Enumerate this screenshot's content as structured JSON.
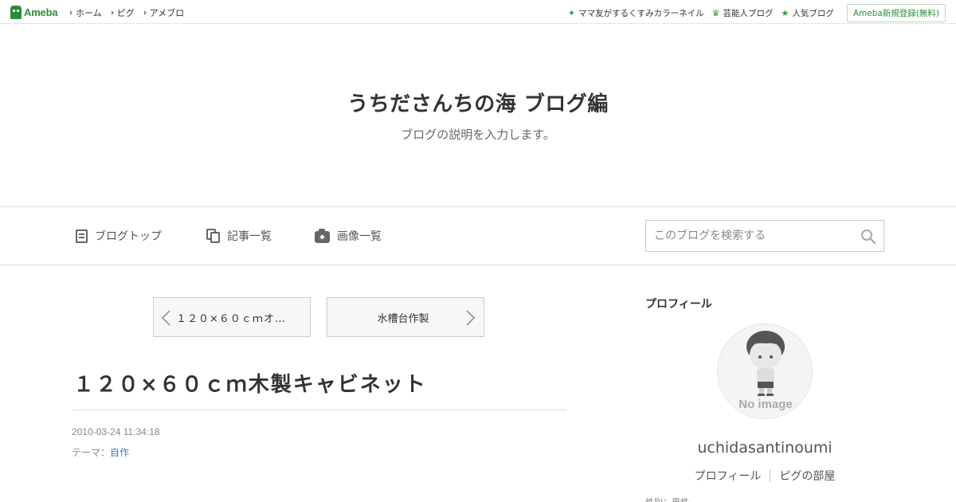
{
  "topbar": {
    "logo_text": "Ameba",
    "nav": [
      "ホーム",
      "ピグ",
      "アメブロ"
    ],
    "links": [
      {
        "label": "ママ友がするくすみカラーネイル",
        "icon": "star-icon"
      },
      {
        "label": "芸能人ブログ",
        "icon": "crown-icon"
      },
      {
        "label": "人気ブログ",
        "icon": "star-icon"
      }
    ],
    "register_label": "Ameba新規登録(無料)"
  },
  "blog": {
    "title": "うちださんちの海 ブログ編",
    "description": "ブログの説明を入力します。"
  },
  "gnav": {
    "items": [
      {
        "label": "ブログトップ",
        "icon": "document-icon"
      },
      {
        "label": "記事一覧",
        "icon": "copy-icon"
      },
      {
        "label": "画像一覧",
        "icon": "camera-icon"
      }
    ],
    "search_placeholder": "このブログを検索する"
  },
  "entry": {
    "prev_label": "１２０×６０ｃｍオ…",
    "next_label": "水槽台作製",
    "title": "１２０×６０ｃｍ木製キャビネット",
    "date": "2010-03-24 11:34:18",
    "theme_prefix": "テーマ：",
    "theme": "自作"
  },
  "sidebar": {
    "heading": "プロフィール",
    "avatar_text": "No image",
    "name": "uchidasantinoumi",
    "links": [
      "プロフィール",
      "ピグの部屋"
    ],
    "cutoff_text": "性別：男性"
  },
  "colors": {
    "brand": "#2d8c3c",
    "link": "#3b7cbd",
    "text": "#333333"
  }
}
